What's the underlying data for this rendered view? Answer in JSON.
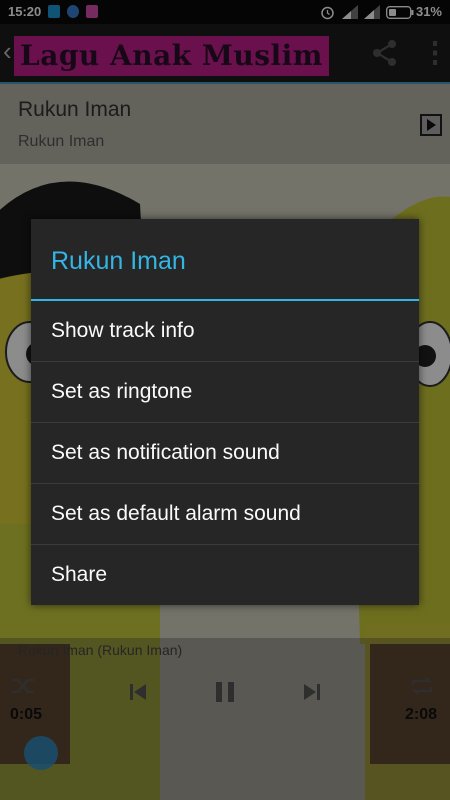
{
  "status_bar": {
    "time": "15:20",
    "battery": "31%"
  },
  "app_bar": {
    "back_glyph": "‹",
    "title": "Lagu Anak Muslim"
  },
  "now_playing_header": {
    "title": "Rukun Iman",
    "artist": "Rukun Iman"
  },
  "player": {
    "now_playing": "Rukun Iman (Rukun Iman)",
    "elapsed": "0:05",
    "duration": "2:08"
  },
  "dialog": {
    "title": "Rukun Iman",
    "items": [
      {
        "label": "Show track info"
      },
      {
        "label": "Set as ringtone"
      },
      {
        "label": "Set as notification sound"
      },
      {
        "label": "Set as default alarm sound"
      },
      {
        "label": "Share"
      }
    ]
  },
  "colors": {
    "accent": "#33b5e5",
    "dialog_bg": "#262626",
    "logo_bg": "#c01e8c"
  }
}
